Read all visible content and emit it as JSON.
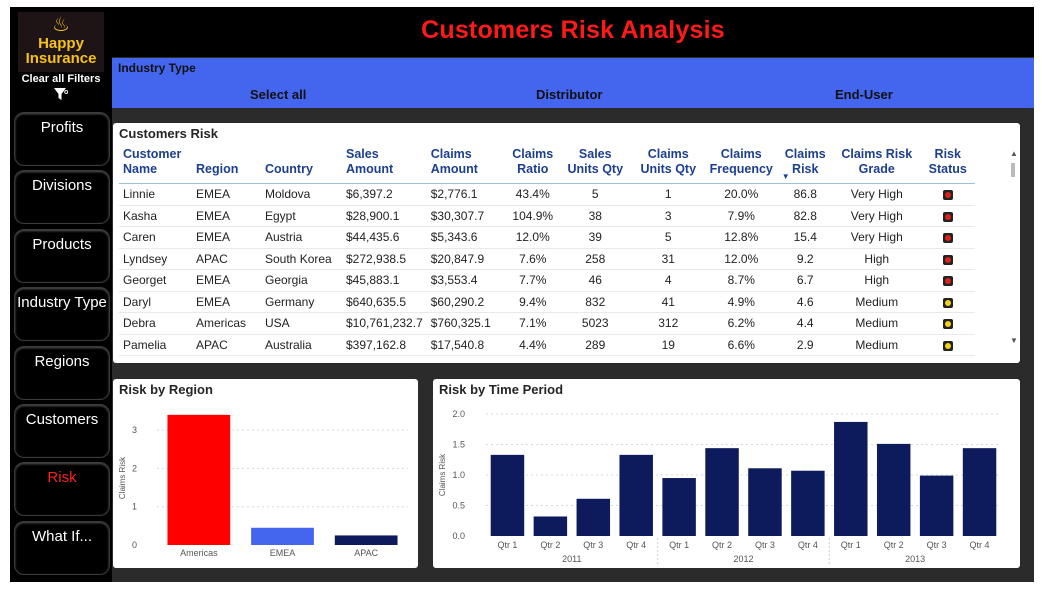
{
  "logo": {
    "flame": "♨",
    "line1": "Happy",
    "line2": "Insurance"
  },
  "clear_filters": {
    "label": "Clear all Filters",
    "icon": "funnel-icon"
  },
  "nav": [
    {
      "label": "Profits",
      "active": false
    },
    {
      "label": "Divisions",
      "active": false
    },
    {
      "label": "Products",
      "active": false
    },
    {
      "label": "Industry Type",
      "active": false
    },
    {
      "label": "Regions",
      "active": false
    },
    {
      "label": "Customers",
      "active": false
    },
    {
      "label": "Risk",
      "active": true
    },
    {
      "label": "What If...",
      "active": false
    }
  ],
  "header": {
    "title": "Customers Risk Analysis"
  },
  "slicer": {
    "label": "Industry Type",
    "options": [
      "Select all",
      "Distributor",
      "End-User"
    ]
  },
  "risk_table": {
    "title": "Customers Risk",
    "columns": [
      "Customer Name",
      "Region",
      "Country",
      "Sales Amount",
      "Claims Amount",
      "Claims Ratio",
      "Sales Units Qty",
      "Claims Units Qty",
      "Claims Frequency",
      "Claims Risk",
      "Claims Risk Grade",
      "Risk Status"
    ],
    "sort_indicator": "▼",
    "rows": [
      [
        "Linnie",
        "EMEA",
        "Moldova",
        "$6,397.2",
        "$2,776.1",
        "43.4%",
        "5",
        "1",
        "20.0%",
        "86.8",
        "Very High",
        "red"
      ],
      [
        "Kasha",
        "EMEA",
        "Egypt",
        "$28,900.1",
        "$30,307.7",
        "104.9%",
        "38",
        "3",
        "7.9%",
        "82.8",
        "Very High",
        "red"
      ],
      [
        "Caren",
        "EMEA",
        "Austria",
        "$44,435.6",
        "$5,343.6",
        "12.0%",
        "39",
        "5",
        "12.8%",
        "15.4",
        "Very High",
        "red"
      ],
      [
        "Lyndsey",
        "APAC",
        "South Korea",
        "$272,938.5",
        "$20,847.9",
        "7.6%",
        "258",
        "31",
        "12.0%",
        "9.2",
        "High",
        "red"
      ],
      [
        "Georget",
        "EMEA",
        "Georgia",
        "$45,883.1",
        "$3,553.4",
        "7.7%",
        "46",
        "4",
        "8.7%",
        "6.7",
        "High",
        "red"
      ],
      [
        "Daryl",
        "EMEA",
        "Germany",
        "$640,635.5",
        "$60,290.2",
        "9.4%",
        "832",
        "41",
        "4.9%",
        "4.6",
        "Medium",
        "yellow"
      ],
      [
        "Debra",
        "Americas",
        "USA",
        "$10,761,232.7",
        "$760,325.1",
        "7.1%",
        "5023",
        "312",
        "6.2%",
        "4.4",
        "Medium",
        "yellow"
      ],
      [
        "Pamelia",
        "APAC",
        "Australia",
        "$397,162.8",
        "$17,540.8",
        "4.4%",
        "289",
        "19",
        "6.6%",
        "2.9",
        "Medium",
        "yellow"
      ]
    ],
    "status_colors": {
      "red": "#e0201c",
      "yellow": "#f2d21a"
    }
  },
  "chart_data": [
    {
      "type": "bar",
      "title": "Risk by Region",
      "ylabel": "Claims Risk",
      "xlabel": "",
      "categories": [
        "Americas",
        "EMEA",
        "APAC"
      ],
      "values": [
        3.4,
        0.45,
        0.25
      ],
      "colors": [
        "#ff0000",
        "#4466ee",
        "#0d1a5c"
      ],
      "ylim": [
        0,
        3.5
      ],
      "yticks": [
        0,
        1,
        2,
        3
      ],
      "grid": true
    },
    {
      "type": "bar",
      "title": "Risk by Time Period",
      "ylabel": "Claims Risk",
      "xlabel": "",
      "categories": [
        "Qtr 1",
        "Qtr 2",
        "Qtr 3",
        "Qtr 4",
        "Qtr 1",
        "Qtr 2",
        "Qtr 3",
        "Qtr 4",
        "Qtr 1",
        "Qtr 2",
        "Qtr 3",
        "Qtr 4"
      ],
      "groups": [
        "2011",
        "2012",
        "2013"
      ],
      "values": [
        1.33,
        0.32,
        0.61,
        1.33,
        0.95,
        1.44,
        1.11,
        1.07,
        1.87,
        1.51,
        0.99,
        1.44
      ],
      "color": "#0d1a5c",
      "ylim": [
        0,
        2.0
      ],
      "yticks": [
        "0.0",
        "0.5",
        "1.0",
        "1.5",
        "2.0"
      ],
      "grid": true
    }
  ]
}
